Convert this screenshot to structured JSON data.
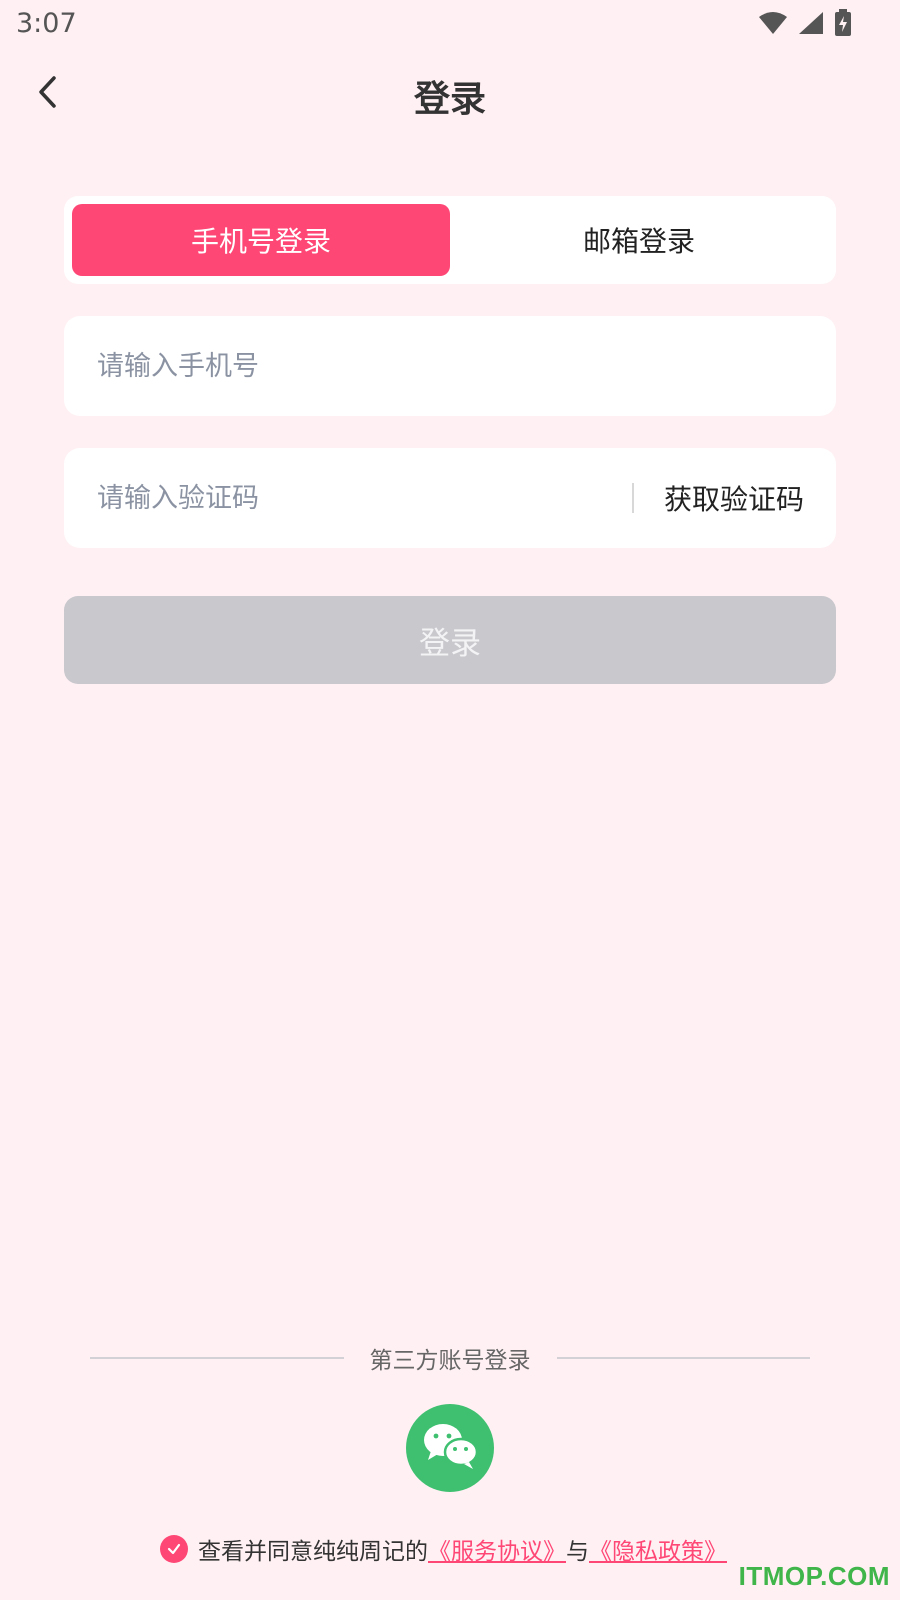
{
  "status_bar": {
    "time": "3:07",
    "icons": [
      "wifi-icon",
      "signal-icon",
      "battery-charging-icon"
    ]
  },
  "header": {
    "title": "登录",
    "back_icon": "chevron-left-icon"
  },
  "tabs": [
    {
      "label": "手机号登录",
      "active": true
    },
    {
      "label": "邮箱登录",
      "active": false
    }
  ],
  "form": {
    "phone_placeholder": "请输入手机号",
    "phone_value": "",
    "code_placeholder": "请输入验证码",
    "code_value": "",
    "get_code_label": "获取验证码",
    "login_label": "登录"
  },
  "third_party": {
    "label": "第三方账号登录",
    "wechat_icon": "wechat-icon"
  },
  "agreement": {
    "checked": true,
    "prefix": "查看并同意纯纯周记的",
    "terms_link": "《服务协议》",
    "connector": "与",
    "privacy_link": "《隐私政策》"
  },
  "watermark": "ITMOP.COM",
  "colors": {
    "accent": "#ff4776",
    "background": "#fff0f3",
    "disabled_button": "#c9c8cd",
    "wechat": "#3ec070"
  }
}
